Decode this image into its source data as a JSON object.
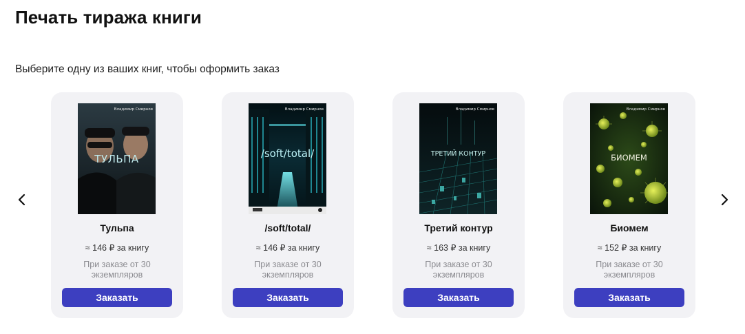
{
  "header": {
    "title": "Печать тиража книги",
    "subtitle": "Выберите одну из ваших книг, чтобы оформить заказ"
  },
  "carousel": {
    "prev_icon": "chevron-left-icon",
    "next_icon": "chevron-right-icon"
  },
  "books": [
    {
      "name": "Тульпа",
      "price": "≈ 146 ₽ за книгу",
      "note": "При заказе от 30 экземпляров",
      "button": "Заказать",
      "cover_title": "ТУЛЬПА",
      "cover_author": "Владимир Смирнов",
      "cover_colors": [
        "#1c2a33",
        "#4a5a5e",
        "#0d1418"
      ]
    },
    {
      "name": "/soft/total/",
      "price": "≈ 146 ₽ за книгу",
      "note": "При заказе от 30 экземпляров",
      "button": "Заказать",
      "cover_title": "/soft/total/",
      "cover_author": "Владимир Смирнов",
      "cover_colors": [
        "#051418",
        "#0f3a44",
        "#5ee0e8"
      ]
    },
    {
      "name": "Третий контур",
      "price": "≈ 163 ₽ за книгу",
      "note": "При заказе от 30 экземпляров",
      "button": "Заказать",
      "cover_title": "ТРЕТИЙ КОНТУР",
      "cover_author": "Владимир Смирнов",
      "cover_colors": [
        "#061014",
        "#0e2a2e",
        "#3fb6b0"
      ]
    },
    {
      "name": "Биомем",
      "price": "≈ 152 ₽ за книгу",
      "note": "При заказе от 30 экземпляров",
      "button": "Заказать",
      "cover_title": "БИОМЕМ",
      "cover_author": "Владимир Смирнов",
      "cover_colors": [
        "#0d1a0a",
        "#2f4a1a",
        "#b8c83a"
      ]
    }
  ]
}
